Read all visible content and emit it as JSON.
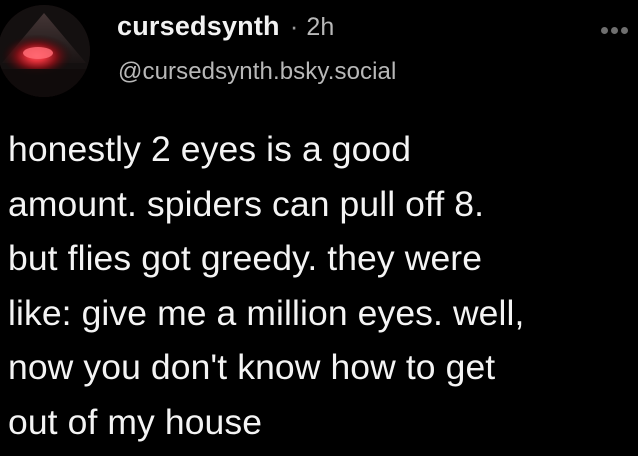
{
  "post": {
    "author": {
      "display_name": "cursedsynth",
      "handle": "@cursedsynth.bsky.social",
      "avatar_icon": "red-glow-avatar"
    },
    "separator": "·",
    "time": "2h",
    "more_icon": "more-dots-icon",
    "body_lines": [
      "honestly 2 eyes is a good",
      "amount. spiders can pull off 8.",
      "but flies got greedy. they were",
      "like: give me a million eyes. well,",
      "now you don't know how to get",
      "out of my house"
    ]
  },
  "colors": {
    "background": "#000000",
    "text": "#f4f4f4",
    "muted": "#b8b8b8",
    "avatar_glow": "#e0303a"
  }
}
